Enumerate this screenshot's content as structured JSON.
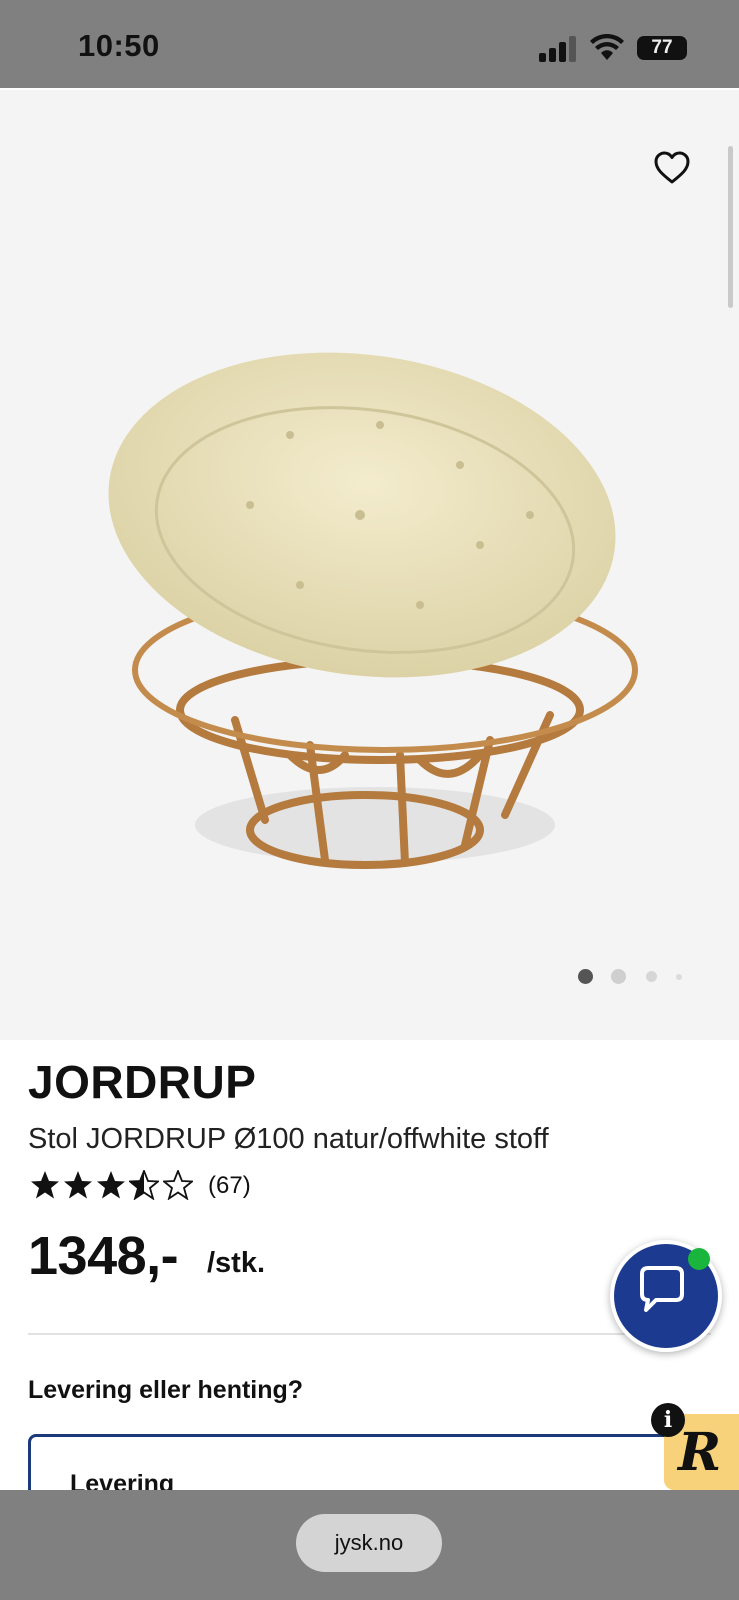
{
  "status_bar": {
    "time": "10:50",
    "battery": "77"
  },
  "product": {
    "title": "JORDRUP",
    "subtitle": "Stol JORDRUP Ø100 natur/offwhite stoff",
    "rating": {
      "value": 3.5,
      "max": 5,
      "count": "(67)"
    },
    "price": "1348,-",
    "unit": "/stk."
  },
  "gallery": {
    "image_count": 4,
    "active_index": 0
  },
  "delivery": {
    "question": "Levering eller henting?",
    "option_label": "Levering"
  },
  "browser": {
    "url": "jysk.no"
  },
  "colors": {
    "brand_blue": "#1c3a8f",
    "online_green": "#19b53c",
    "widget_yellow": "#f7d27a"
  },
  "icons": {
    "favorite": "heart-outline-icon",
    "chat": "chat-bubble-icon",
    "info": "info-icon",
    "widget": "r-logo-icon"
  }
}
